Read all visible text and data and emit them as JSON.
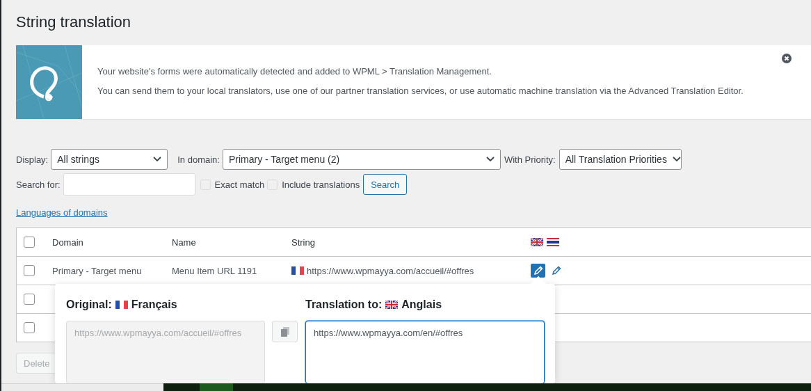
{
  "title": "String translation",
  "notice": {
    "lines": [
      "Your website's forms were automatically detected and added to WPML > Translation Management.",
      "You can send them to your local translators, use one of our partner translation services, or use automatic machine translation via the Advanced Translation Editor."
    ]
  },
  "filters": [
    {
      "label": "Display:",
      "value": "All strings"
    },
    {
      "label": "In domain:",
      "value": "Primary - Target menu (2)"
    },
    {
      "label": "With Priority:",
      "value": "All Translation Priorities"
    }
  ],
  "search": {
    "label": "Search for:",
    "options": [
      {
        "label": "Exact match",
        "checked": false
      },
      {
        "label": "Include translations",
        "checked": false
      }
    ],
    "button": "Search"
  },
  "link": "Languages of domains",
  "table": {
    "columns": [
      "Domain",
      "Name",
      "String"
    ],
    "rows": [
      {
        "checked": false,
        "domain": "Primary - Target menu",
        "name": "Menu Item URL 1191",
        "string": "https://www.wpmayya.com/accueil/#offres",
        "translations": [
          {
            "selected": true
          },
          {
            "selected": false
          }
        ]
      },
      {
        "checked": false
      },
      {
        "checked": false
      }
    ],
    "header_checked": false
  },
  "bulk_button": "Delete",
  "editor": {
    "original_label": "Original:",
    "original_language": "Français",
    "original_value": "https://www.wpmayya.com/accueil/#offres",
    "translation_label": "Translation to:",
    "translation_language": "Anglais",
    "translation_value": "https://www.wpmayya.com/en/#offres"
  }
}
